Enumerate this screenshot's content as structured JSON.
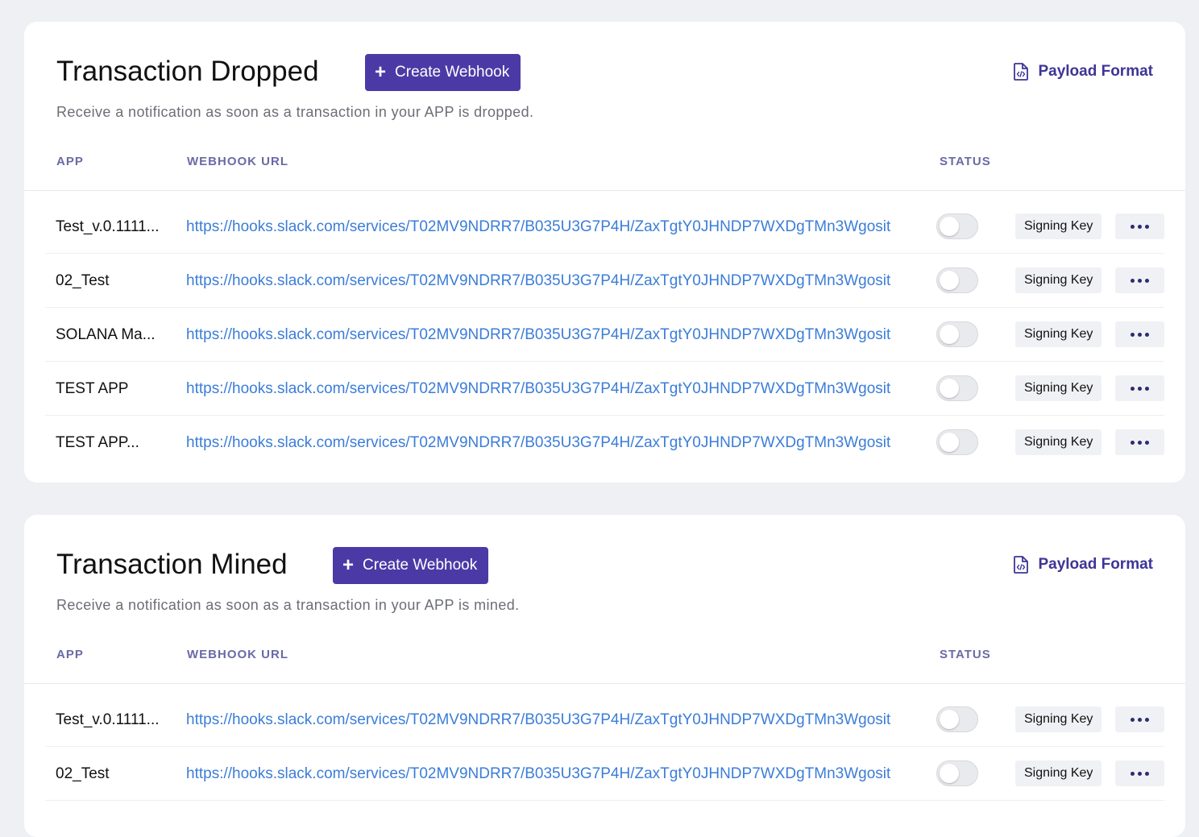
{
  "colors": {
    "accent": "#4b3aa6",
    "link": "#3b7dd8",
    "header_text": "#6a6aa6"
  },
  "sections": [
    {
      "title": "Transaction Dropped",
      "create_label": "Create Webhook",
      "payload_label": "Payload Format",
      "payload_icon": "file-code-icon",
      "description": "Receive a notification as soon as a transaction in your APP is dropped.",
      "columns": {
        "app": "APP",
        "url": "WEBHOOK URL",
        "status": "STATUS"
      },
      "rows": [
        {
          "app": "Test_v.0.1111...",
          "url": "https://hooks.slack.com/services/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osit",
          "status_on": false,
          "signing_label": "Signing Key"
        },
        {
          "app": "02_Test",
          "url": "https://hooks.slack.com/services/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osit",
          "status_on": false,
          "signing_label": "Signing Key"
        },
        {
          "app": "SOLANA Ma...",
          "url": "https://hooks.slack.com/services/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osit",
          "status_on": false,
          "signing_label": "Signing Key"
        },
        {
          "app": "TEST APP",
          "url": "https://hooks.slack.com/services/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osit",
          "status_on": false,
          "signing_label": "Signing Key"
        },
        {
          "app": "TEST APP...",
          "url": "https://hooks.slack.com/services/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osit",
          "status_on": false,
          "signing_label": "Signing Key"
        }
      ]
    },
    {
      "title": "Transaction Mined",
      "create_label": "Create Webhook",
      "payload_label": "Payload Format",
      "payload_icon": "file-code-icon",
      "description": "Receive a notification as soon as a transaction in your APP is mined.",
      "columns": {
        "app": "APP",
        "url": "WEBHOOK URL",
        "status": "STATUS"
      },
      "rows": [
        {
          "app": "Test_v.0.1111...",
          "url": "https://hooks.slack.com/services/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osit",
          "status_on": false,
          "signing_label": "Signing Key"
        },
        {
          "app": "02_Test",
          "url": "https://hooks.slack.com/services/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osit",
          "status_on": false,
          "signing_label": "Signing Key"
        }
      ]
    }
  ]
}
